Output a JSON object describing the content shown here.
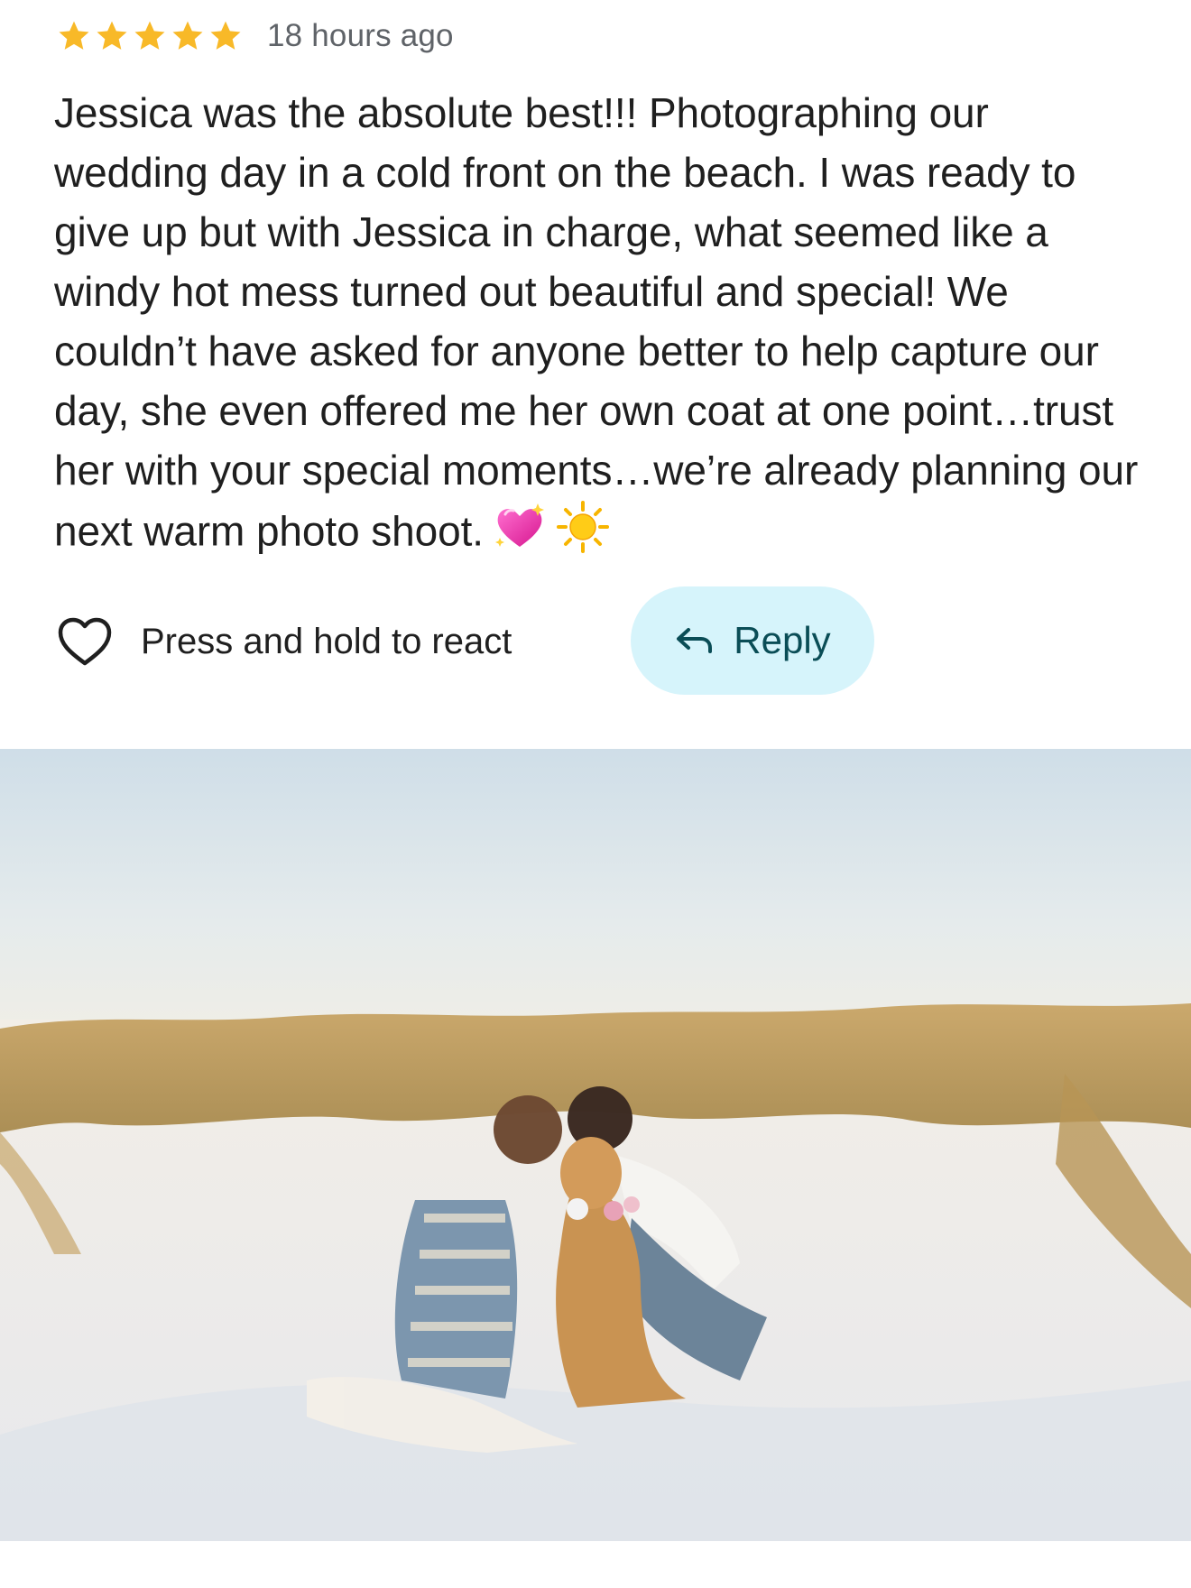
{
  "review": {
    "rating": 5,
    "rating_max": 5,
    "star_color": "#f8b928",
    "time": "18 hours ago",
    "text": "Jessica was the absolute best!!! Photographing our wedding day in a cold front on the beach. I was ready to give up but with Jessica in charge, what seemed like a windy hot mess turned out beautiful and special! We couldn’t have asked for anyone better to help capture our day, she even offered me her own coat at one point…trust her with your special moments…we’re already planning our next warm photo shoot.",
    "emojis": [
      "sparkling-heart-emoji",
      "sun-emoji"
    ]
  },
  "actions": {
    "react_label": "Press and hold to react",
    "reply_label": "Reply",
    "reply_bg": "#d6f4fb",
    "reply_color": "#0a4d56"
  },
  "photo": {
    "subject": "couple kissing with dog on sandy beach dunes"
  }
}
